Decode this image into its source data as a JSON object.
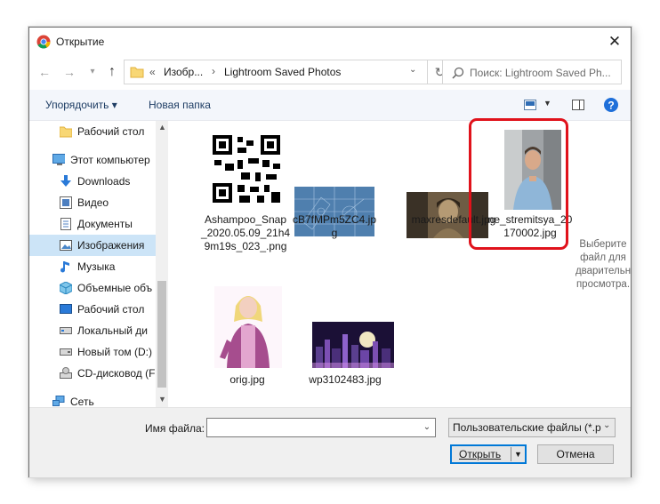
{
  "window": {
    "title": "Открытие"
  },
  "nav": {
    "address_segments": [
      "«",
      "Изобр...",
      "›",
      "Lightroom Saved Photos"
    ],
    "search_placeholder": "Поиск: Lightroom Saved Ph..."
  },
  "toolbar": {
    "organize": "Упорядочить ▾",
    "new_folder": "Новая папка"
  },
  "sidebar": {
    "items": [
      {
        "label": "Рабочий стол",
        "icon": "folder-icon"
      },
      {
        "label": "Этот компьютер",
        "icon": "computer-icon"
      },
      {
        "label": "Downloads",
        "icon": "download-icon"
      },
      {
        "label": "Видео",
        "icon": "video-icon"
      },
      {
        "label": "Документы",
        "icon": "documents-icon"
      },
      {
        "label": "Изображения",
        "icon": "pictures-icon",
        "selected": true
      },
      {
        "label": "Музыка",
        "icon": "music-icon"
      },
      {
        "label": "Объемные объ",
        "icon": "3d-objects-icon"
      },
      {
        "label": "Рабочий стол",
        "icon": "desktop-icon"
      },
      {
        "label": "Локальный ди",
        "icon": "drive-icon"
      },
      {
        "label": "Новый том (D:)",
        "icon": "drive-icon"
      },
      {
        "label": "CD-дисковод (F:",
        "icon": "cd-drive-icon"
      },
      {
        "label": "Сеть",
        "icon": "network-icon"
      }
    ]
  },
  "files": [
    {
      "name_line1": "Ashampoo_Snap",
      "name_line2": "_2020.05.09_21h4",
      "name_line3": "9m19s_023_.png",
      "thumb": "qr-code-thumbnail"
    },
    {
      "name_line1": "cB7fMPm5ZC4.jp",
      "name_line2": "g",
      "name_line3": "",
      "thumb": "blueprint-thumbnail"
    },
    {
      "name_line1": "maxresdefault.jpg",
      "name_line2": "",
      "name_line3": "",
      "thumb": "sepia-portrait-thumbnail"
    },
    {
      "name_line1": "ne_stremitsya_20",
      "name_line2": "170002.jpg",
      "name_line3": "",
      "thumb": "man-portrait-thumbnail"
    },
    {
      "name_line1": "orig.jpg",
      "name_line2": "",
      "name_line3": "",
      "thumb": "girl-illustration-thumbnail"
    },
    {
      "name_line1": "wp3102483.jpg",
      "name_line2": "",
      "name_line3": "",
      "thumb": "city-night-thumbnail"
    }
  ],
  "preview": {
    "line1": "Выберите",
    "line2": "файл для",
    "line3": "дварительн",
    "line4": "просмотра."
  },
  "bottom": {
    "filename_label": "Имя файла:",
    "filename_value": "",
    "filetype": "Пользовательские файлы (*.p",
    "open": "Открыть",
    "cancel": "Отмена"
  },
  "colors": {
    "highlight": "#e0121b",
    "selected": "#cce4f7",
    "accent": "#0078d7",
    "help": "#1e6fd9"
  }
}
